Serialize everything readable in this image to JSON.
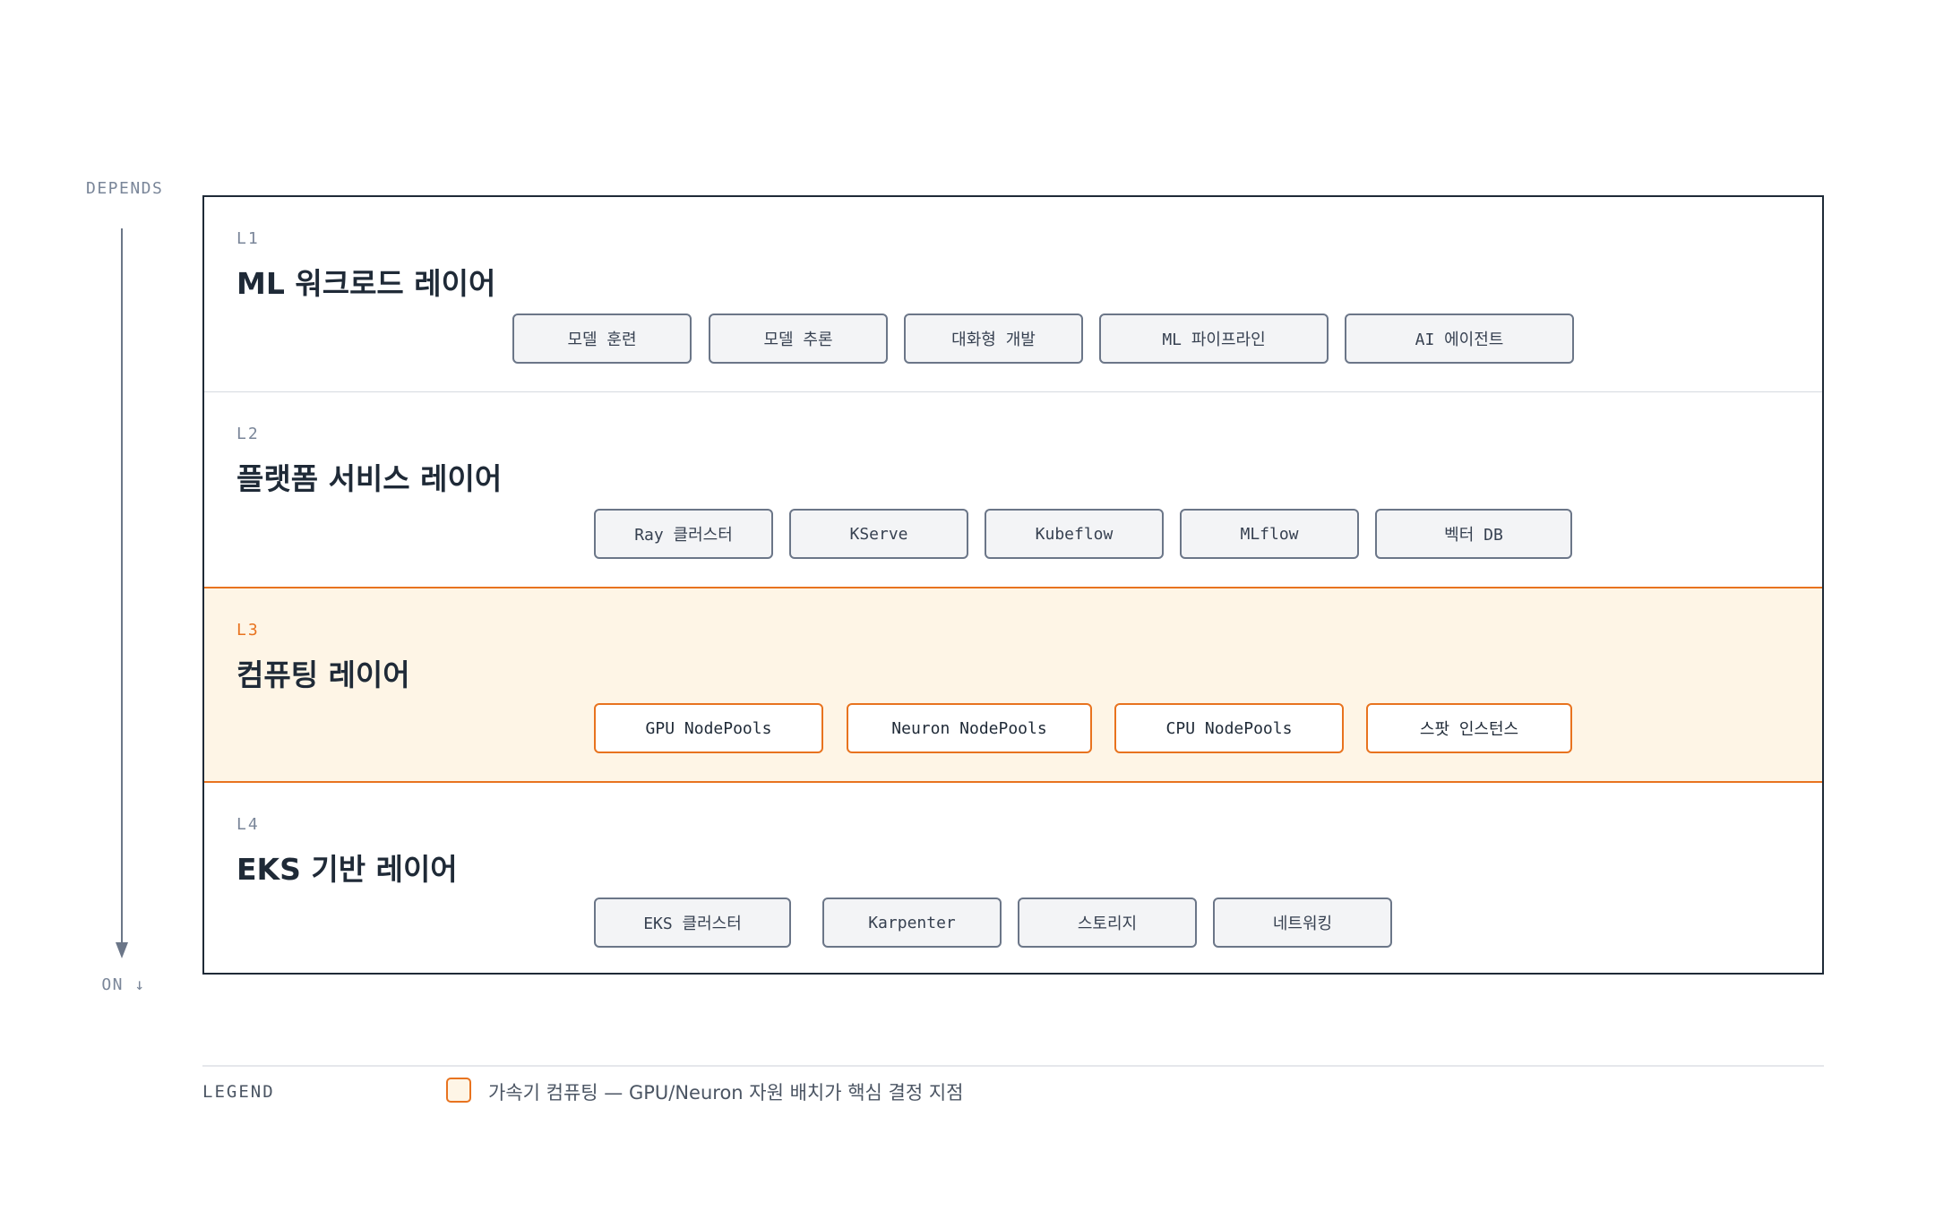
{
  "axis": {
    "top_label": "DEPENDS",
    "bottom_label": "ON ↓"
  },
  "layers": [
    {
      "id": "L1",
      "title": "ML 워크로드 레이어",
      "chips": [
        "모델 훈련",
        "모델 추론",
        "대화형 개발",
        "ML 파이프라인",
        "AI 에이전트"
      ]
    },
    {
      "id": "L2",
      "title": "플랫폼 서비스 레이어",
      "chips": [
        "Ray 클러스터",
        "KServe",
        "Kubeflow",
        "MLflow",
        "벡터 DB"
      ]
    },
    {
      "id": "L3",
      "title": "컴퓨팅 레이어",
      "highlighted": true,
      "chips": [
        "GPU NodePools",
        "Neuron NodePools",
        "CPU NodePools",
        "스팟 인스턴스"
      ]
    },
    {
      "id": "L4",
      "title": "EKS 기반 레이어",
      "chips": [
        "EKS 클러스터",
        "Karpenter",
        "스토리지",
        "네트워킹"
      ]
    }
  ],
  "legend": {
    "label": "LEGEND",
    "items": [
      {
        "text": "가속기 컴퓨팅 — GPU/Neuron 자원 배치가 핵심 결정 지점"
      }
    ]
  },
  "colors": {
    "ink": "#1f2a37",
    "accent": "#e8731f",
    "accent_fill": "#fef5e6",
    "muted": "#7a8699",
    "chip_fill": "#f3f4f6",
    "chip_border": "#6b7688"
  }
}
